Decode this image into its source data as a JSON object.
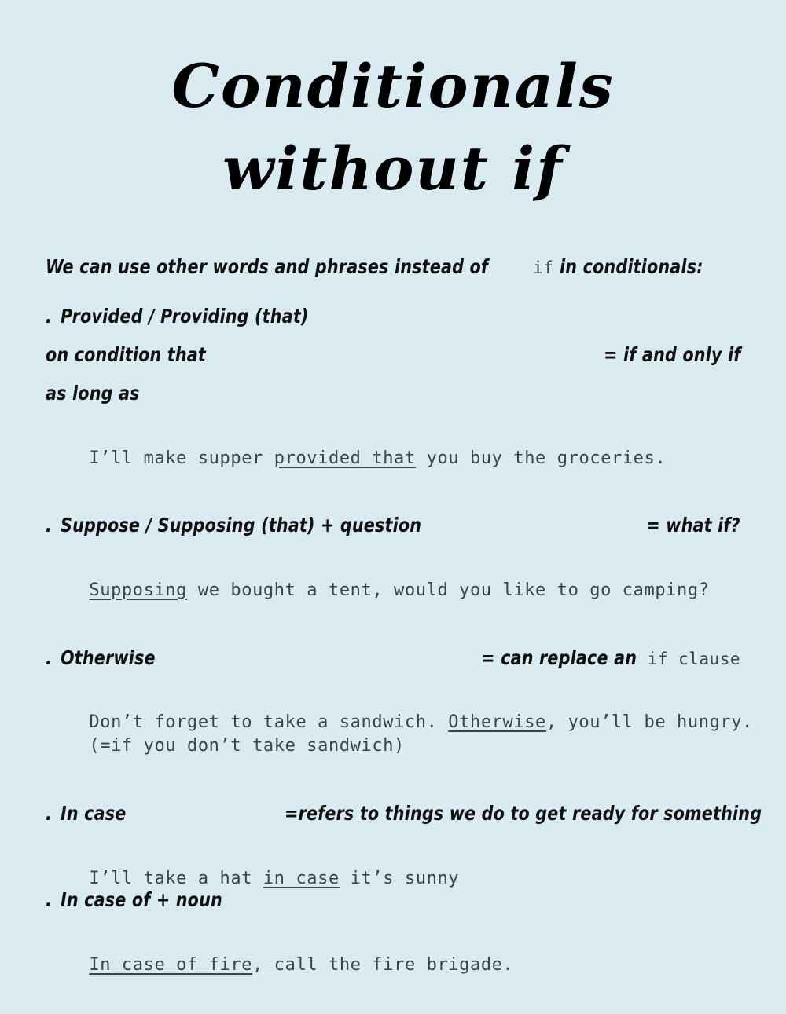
{
  "page": {
    "background_color": "#daeaf1",
    "text_color": "#111111",
    "mono_text_color": "#3c4245"
  },
  "title": {
    "line1": "Conditionals",
    "line2": "without if"
  },
  "intro": {
    "before": "We can use other words and phrases instead of",
    "keyword": "if",
    "after": "in conditionals:"
  },
  "bullet_mark": ".",
  "sections": [
    {
      "id": "provided",
      "headings": [
        "Provided / Providing (that)",
        "on condition that",
        "as long as"
      ],
      "annotation": "= if and only if",
      "examples": [
        {
          "before": "I’ll make supper ",
          "underlined": "provided that",
          "after": " you buy the groceries."
        }
      ]
    },
    {
      "id": "suppose",
      "headings": [
        "Suppose / Supposing (that) + question"
      ],
      "annotation": "= what if?",
      "examples": [
        {
          "before": "",
          "underlined": "Supposing",
          "after": " we bought a tent, would you like to go camping?"
        }
      ]
    },
    {
      "id": "otherwise",
      "headings": [
        "Otherwise"
      ],
      "annotation_hand": "= can replace an",
      "annotation_mono": "if clause",
      "examples": [
        {
          "before": "Don’t forget to take a sandwich. ",
          "underlined": "Otherwise",
          "after": ", you’ll be hungry."
        },
        {
          "before": "(=if you don’t take sandwich)",
          "underlined": "",
          "after": ""
        }
      ]
    },
    {
      "id": "in-case",
      "headings": [
        "In case"
      ],
      "annotation": "=refers to things we do to get ready for something",
      "examples": [
        {
          "before": "I’ll take a hat ",
          "underlined": "in case",
          "after": " it’s sunny"
        }
      ]
    },
    {
      "id": "in-case-of",
      "headings": [
        "In case of + noun"
      ],
      "annotation": "",
      "examples": [
        {
          "before": "",
          "underlined": "In case of fire",
          "after": ", call the fire brigade."
        }
      ]
    }
  ]
}
